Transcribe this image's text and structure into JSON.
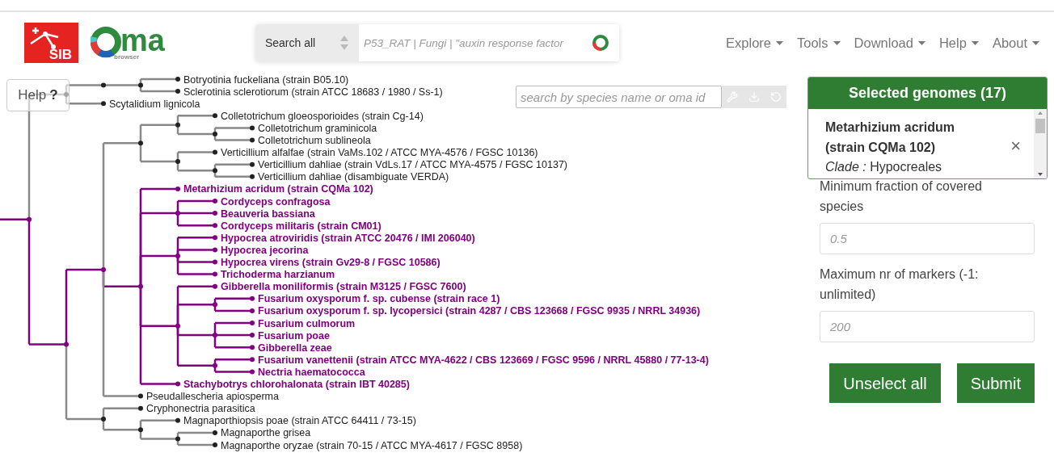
{
  "header": {
    "sib_logo": "SIB",
    "oma_logo": {
      "letters": "ma",
      "subtitle": "browser"
    },
    "search": {
      "scope": "Search all",
      "placeholder": "P53_RAT | Fungi | \"auxin response factor"
    },
    "nav": [
      "Explore",
      "Tools",
      "Download",
      "Help",
      "About"
    ]
  },
  "help_button": "Help",
  "help_mark": "?",
  "species_search": {
    "placeholder": "search by species name or oma id"
  },
  "tree": {
    "children": [
      {
        "children": [
          {
            "children": [
              {
                "children": [
                  {
                    "name": "Botryotinia fuckeliana (strain B05.10)",
                    "selected": false
                  },
                  {
                    "name": "Sclerotinia sclerotiorum (strain ATCC 18683 / 1980 / Ss-1)",
                    "selected": false
                  }
                ]
              }
            ]
          },
          {
            "name": "Scytalidium lignicola",
            "selected": false
          }
        ]
      },
      {
        "children": [
          {
            "children": [
              {
                "children": [
                  {
                    "children": [
                      {
                        "name": "Colletotrichum gloeosporioides (strain Cg-14)",
                        "selected": false
                      },
                      {
                        "children": [
                          {
                            "name": "Colletotrichum graminicola",
                            "selected": false
                          },
                          {
                            "name": "Colletotrichum sublineola",
                            "selected": false
                          }
                        ]
                      }
                    ]
                  },
                  {
                    "children": [
                      {
                        "name": "Verticillium alfalfae (strain VaMs.102 / ATCC MYA-4576 / FGSC 10136)",
                        "selected": false
                      },
                      {
                        "children": [
                          {
                            "name": "Verticillium dahliae (strain VdLs.17 / ATCC MYA-4575 / FGSC 10137)",
                            "selected": false
                          },
                          {
                            "name": "Verticillium dahliae (disambiguate VERDA)",
                            "selected": false
                          }
                        ]
                      }
                    ]
                  }
                ]
              },
              {
                "children": [
                  {
                    "name": "Metarhizium acridum (strain CQMa 102)",
                    "selected": true
                  },
                  {
                    "children": [
                      {
                        "name": "Cordyceps confragosa",
                        "selected": true
                      },
                      {
                        "name": "Beauveria bassiana",
                        "selected": true
                      },
                      {
                        "name": "Cordyceps militaris (strain CM01)",
                        "selected": true
                      }
                    ]
                  },
                  {
                    "children": [
                      {
                        "name": "Hypocrea atroviridis (strain ATCC 20476 / IMI 206040)",
                        "selected": true
                      },
                      {
                        "name": "Hypocrea jecorina",
                        "selected": true
                      },
                      {
                        "name": "Hypocrea virens (strain Gv29-8 / FGSC 10586)",
                        "selected": true
                      },
                      {
                        "name": "Trichoderma harzianum",
                        "selected": true
                      }
                    ]
                  },
                  {
                    "children": [
                      {
                        "name": "Gibberella moniliformis (strain M3125 / FGSC 7600)",
                        "selected": true
                      },
                      {
                        "children": [
                          {
                            "name": "Fusarium oxysporum f. sp. cubense (strain race 1)",
                            "selected": true
                          },
                          {
                            "name": "Fusarium oxysporum f. sp. lycopersici (strain 4287 / CBS 123668 / FGSC 9935 / NRRL 34936)",
                            "selected": true
                          }
                        ]
                      },
                      {
                        "children": [
                          {
                            "name": "Fusarium culmorum",
                            "selected": true
                          },
                          {
                            "name": "Fusarium poae",
                            "selected": true
                          },
                          {
                            "name": "Gibberella zeae",
                            "selected": true
                          }
                        ]
                      },
                      {
                        "children": [
                          {
                            "name": "Fusarium vanettenii (strain ATCC MYA-4622 / CBS 123669 / FGSC 9596 / NRRL 45880 / 77-13-4)",
                            "selected": true
                          },
                          {
                            "name": "Nectria haematococca",
                            "selected": true
                          }
                        ]
                      }
                    ]
                  },
                  {
                    "name": "Stachybotrys chlorohalonata (strain IBT 40285)",
                    "selected": true
                  }
                ]
              },
              {
                "name": "Pseudallescheria apiosperma",
                "selected": false
              }
            ]
          },
          {
            "children": [
              {
                "name": "Cryphonectria parasitica",
                "selected": false
              },
              {
                "children": [
                  {
                    "name": "Magnaporthiopsis poae (strain ATCC 64411 / 73-15)",
                    "selected": false
                  },
                  {
                    "children": [
                      {
                        "name": "Magnaporthe grisea",
                        "selected": false
                      },
                      {
                        "name": "Magnaporthe oryzae (strain 70-15 / ATCC MYA-4617 / FGSC 8958)",
                        "selected": false
                      }
                    ]
                  }
                ]
              }
            ]
          }
        ]
      }
    ]
  },
  "selected_panel": {
    "title": "Selected genomes (17)",
    "items": [
      {
        "name": "Metarhizium acridum (strain CQMa 102)",
        "remove": "×",
        "clade_label": "Clade :",
        "clade": "Hypocreales"
      }
    ]
  },
  "form": [
    {
      "label": "Minimum fraction of covered species",
      "placeholder": "0.5"
    },
    {
      "label": "Maximum nr of markers (-1: unlimited)",
      "placeholder": "200"
    }
  ],
  "buttons": [
    "Unselect all",
    "Submit"
  ]
}
